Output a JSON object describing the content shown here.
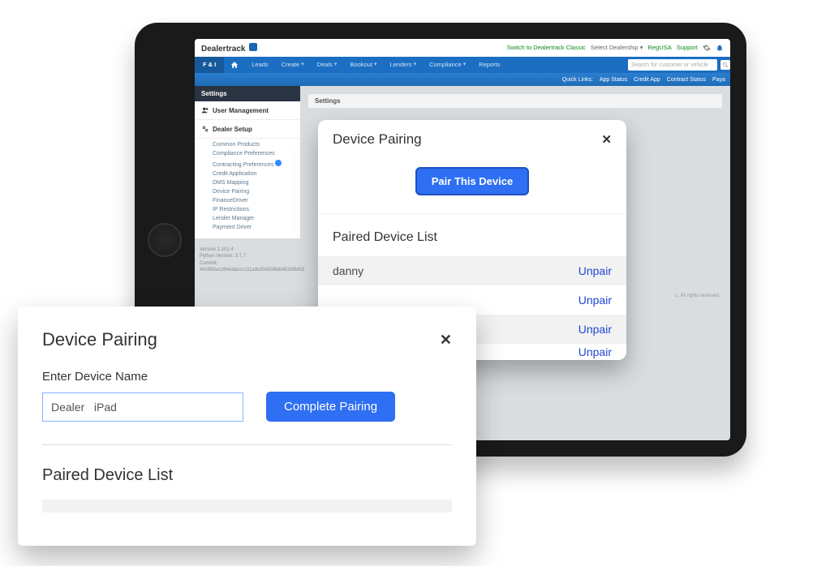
{
  "brand": "Dealertrack",
  "topLinks": {
    "switch": "Switch to Dealertrack Classic",
    "select": "Select Dealership",
    "region": "RegUSA",
    "support": "Support"
  },
  "nav": {
    "fi": "F & I",
    "items": [
      "Leads",
      "Create",
      "Deals",
      "Bookout",
      "Lenders",
      "Compliance",
      "Reports"
    ],
    "searchPlaceholder": "Search for customer or vehicle"
  },
  "quick": {
    "label": "Quick Links:",
    "items": [
      "App Status",
      "Credit App",
      "Contract Status",
      "Paya"
    ]
  },
  "sidebar": {
    "header": "Settings",
    "userMgmt": "User Management",
    "dealerSetup": "Dealer Setup",
    "links": [
      "Common Products",
      "Compliance Preferences",
      "Contracting Preferences",
      "Credit Application",
      "DMS Mapping",
      "Device Pairing",
      "FinanceDriver",
      "IP Restrictions",
      "Lender Manager",
      "Payment Driver"
    ]
  },
  "main": {
    "settings": "Settings"
  },
  "footer": {
    "l1": "Version 2.101.4",
    "l2": "Python Version: 3.7.7",
    "l3": "Commit: 40c658a1d94edaccc111a9c004206b6491fd9d03"
  },
  "copyright": "c. All rights reserved.",
  "modal1": {
    "title": "Device Pairing",
    "pairBtn": "Pair This Device",
    "listTitle": "Paired Device List",
    "rows": [
      {
        "name": "danny",
        "action": "Unpair"
      },
      {
        "name": "",
        "action": "Unpair"
      },
      {
        "name": "",
        "action": "Unpair"
      },
      {
        "name": "",
        "action": "Unpair"
      }
    ]
  },
  "modal2": {
    "title": "Device Pairing",
    "fieldLabel": "Enter Device Name",
    "value": "Dealer   iPad",
    "completeBtn": "Complete Pairing",
    "listTitle": "Paired Device List"
  }
}
